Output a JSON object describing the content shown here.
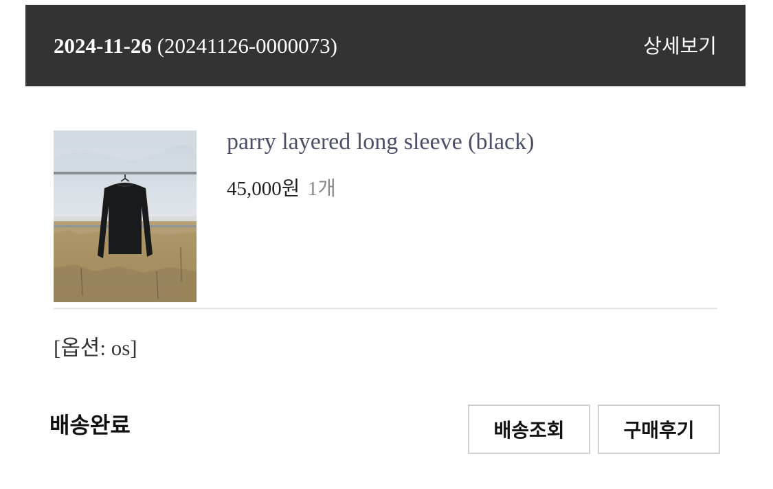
{
  "order": {
    "date": "2024-11-26",
    "number": "(20241126-0000073)",
    "detail_link": "상세보기"
  },
  "product": {
    "image_icon": "product-photo-black-long-sleeve-on-hanger",
    "name": "parry layered long sleeve (black)",
    "price": "45,000원",
    "quantity": "1개",
    "option": "[옵션: os]"
  },
  "status": {
    "label": "배송완료"
  },
  "actions": {
    "track_label": "배송조회",
    "review_label": "구매후기"
  },
  "colors": {
    "header_bg": "#333333",
    "header_text": "#ffffff",
    "product_name": "#4a4f66",
    "quantity_text": "#8a8a8a",
    "button_border": "#d0d0d0"
  }
}
